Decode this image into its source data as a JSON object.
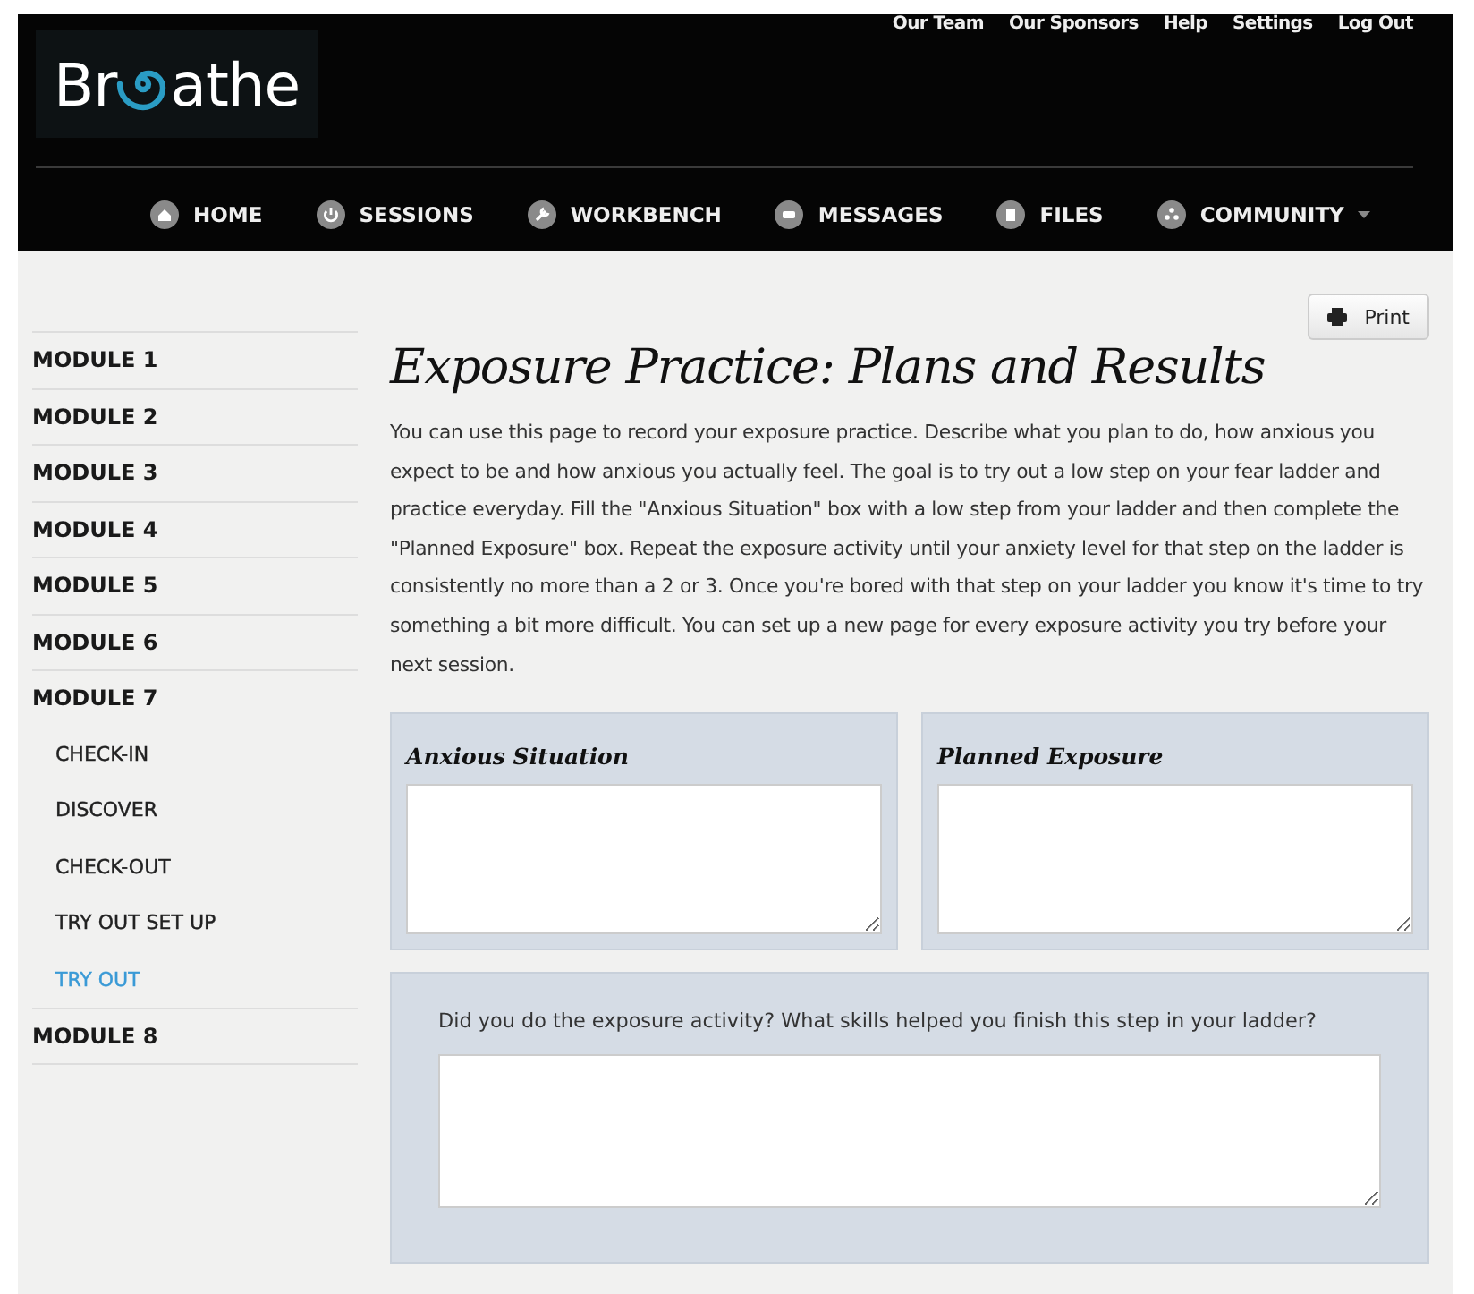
{
  "logo": {
    "before": "Br",
    "after": "athe"
  },
  "top_links": [
    "Our Team",
    "Our Sponsors",
    "Help",
    "Settings",
    "Log Out"
  ],
  "nav": [
    {
      "label": "HOME",
      "dropdown": false
    },
    {
      "label": "SESSIONS",
      "dropdown": false
    },
    {
      "label": "WORKBENCH",
      "dropdown": false
    },
    {
      "label": "MESSAGES",
      "dropdown": false
    },
    {
      "label": "FILES",
      "dropdown": false
    },
    {
      "label": "COMMUNITY",
      "dropdown": true
    }
  ],
  "sidebar": {
    "items": [
      {
        "label": "MODULE 1",
        "kind": "module",
        "selected": false
      },
      {
        "label": "MODULE 2",
        "kind": "module",
        "selected": false
      },
      {
        "label": "MODULE 3",
        "kind": "module",
        "selected": false
      },
      {
        "label": "MODULE 4",
        "kind": "module",
        "selected": false
      },
      {
        "label": "MODULE 5",
        "kind": "module",
        "selected": false
      },
      {
        "label": "MODULE 6",
        "kind": "module",
        "selected": false
      },
      {
        "label": "MODULE 7",
        "kind": "module",
        "selected": false
      },
      {
        "label": "CHECK-IN",
        "kind": "sub",
        "selected": false
      },
      {
        "label": "DISCOVER",
        "kind": "sub",
        "selected": false
      },
      {
        "label": "CHECK-OUT",
        "kind": "sub",
        "selected": false
      },
      {
        "label": "TRY OUT SET UP",
        "kind": "sub",
        "selected": false
      },
      {
        "label": "TRY OUT",
        "kind": "sub",
        "selected": true
      },
      {
        "label": "MODULE 8",
        "kind": "module",
        "selected": false
      }
    ]
  },
  "print_button": "Print",
  "title": "Exposure Practice: Plans and Results",
  "intro": "You can use this page to record your exposure practice. Describe what you plan to do, how anxious you expect to be and how anxious you actually feel. The goal is to try out a low step on your fear ladder and practice everyday. Fill the \"Anxious Situation\" box with a low step from your ladder and then complete the \"Planned Exposure\" box. Repeat the exposure activity until your anxiety level for that step on the ladder is consistently no more than a 2 or 3. Once you're bored with that step on your ladder you know it's time to try something a bit more difficult. You can set up a new page for every exposure activity you try before your next session.",
  "panels": [
    {
      "label": "Anxious Situation",
      "kind": "heading"
    },
    {
      "label": "Planned Exposure",
      "kind": "heading"
    },
    {
      "label": "Did you do the exposure activity? What skills helped you finish this step in your ladder?",
      "kind": "question"
    }
  ]
}
